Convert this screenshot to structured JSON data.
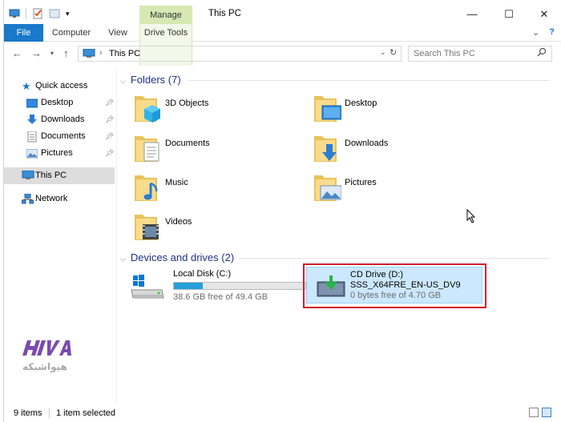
{
  "window": {
    "title": "This PC",
    "context_tab": "Manage",
    "controls": {
      "minimize": "—",
      "maximize": "☐",
      "close": "✕"
    }
  },
  "ribbon": {
    "tabs": [
      "File",
      "Computer",
      "View",
      "Drive Tools"
    ],
    "expand": "⌄",
    "help": "?"
  },
  "address_bar": {
    "path": "This PC",
    "search_placeholder": "Search This PC"
  },
  "nav_pane": {
    "quick_access": "Quick access",
    "pinned": [
      "Desktop",
      "Downloads",
      "Documents",
      "Pictures"
    ],
    "this_pc": "This PC",
    "network": "Network"
  },
  "folders_group": {
    "header": "Folders (7)",
    "items": [
      "3D Objects",
      "Desktop",
      "Documents",
      "Downloads",
      "Music",
      "Pictures",
      "Videos"
    ]
  },
  "drives_group": {
    "header": "Devices and drives (2)",
    "local": {
      "name": "Local Disk (C:)",
      "free": "38.6 GB free of 49.4 GB",
      "used_fraction": 0.22
    },
    "cd": {
      "name": "CD Drive (D:)",
      "label": "SSS_X64FRE_EN-US_DV9",
      "free": "0 bytes free of 4.70 GB"
    }
  },
  "status_bar": {
    "items": "9 items",
    "selected": "1 item selected"
  },
  "colors": {
    "accent": "#1979ca",
    "manage_tab": "#d6e9b2",
    "selection": "#cce8ff",
    "highlight_box": "#d31f2a",
    "group_header": "#1e3287"
  },
  "logo": {
    "text": "هیواشبکه"
  }
}
